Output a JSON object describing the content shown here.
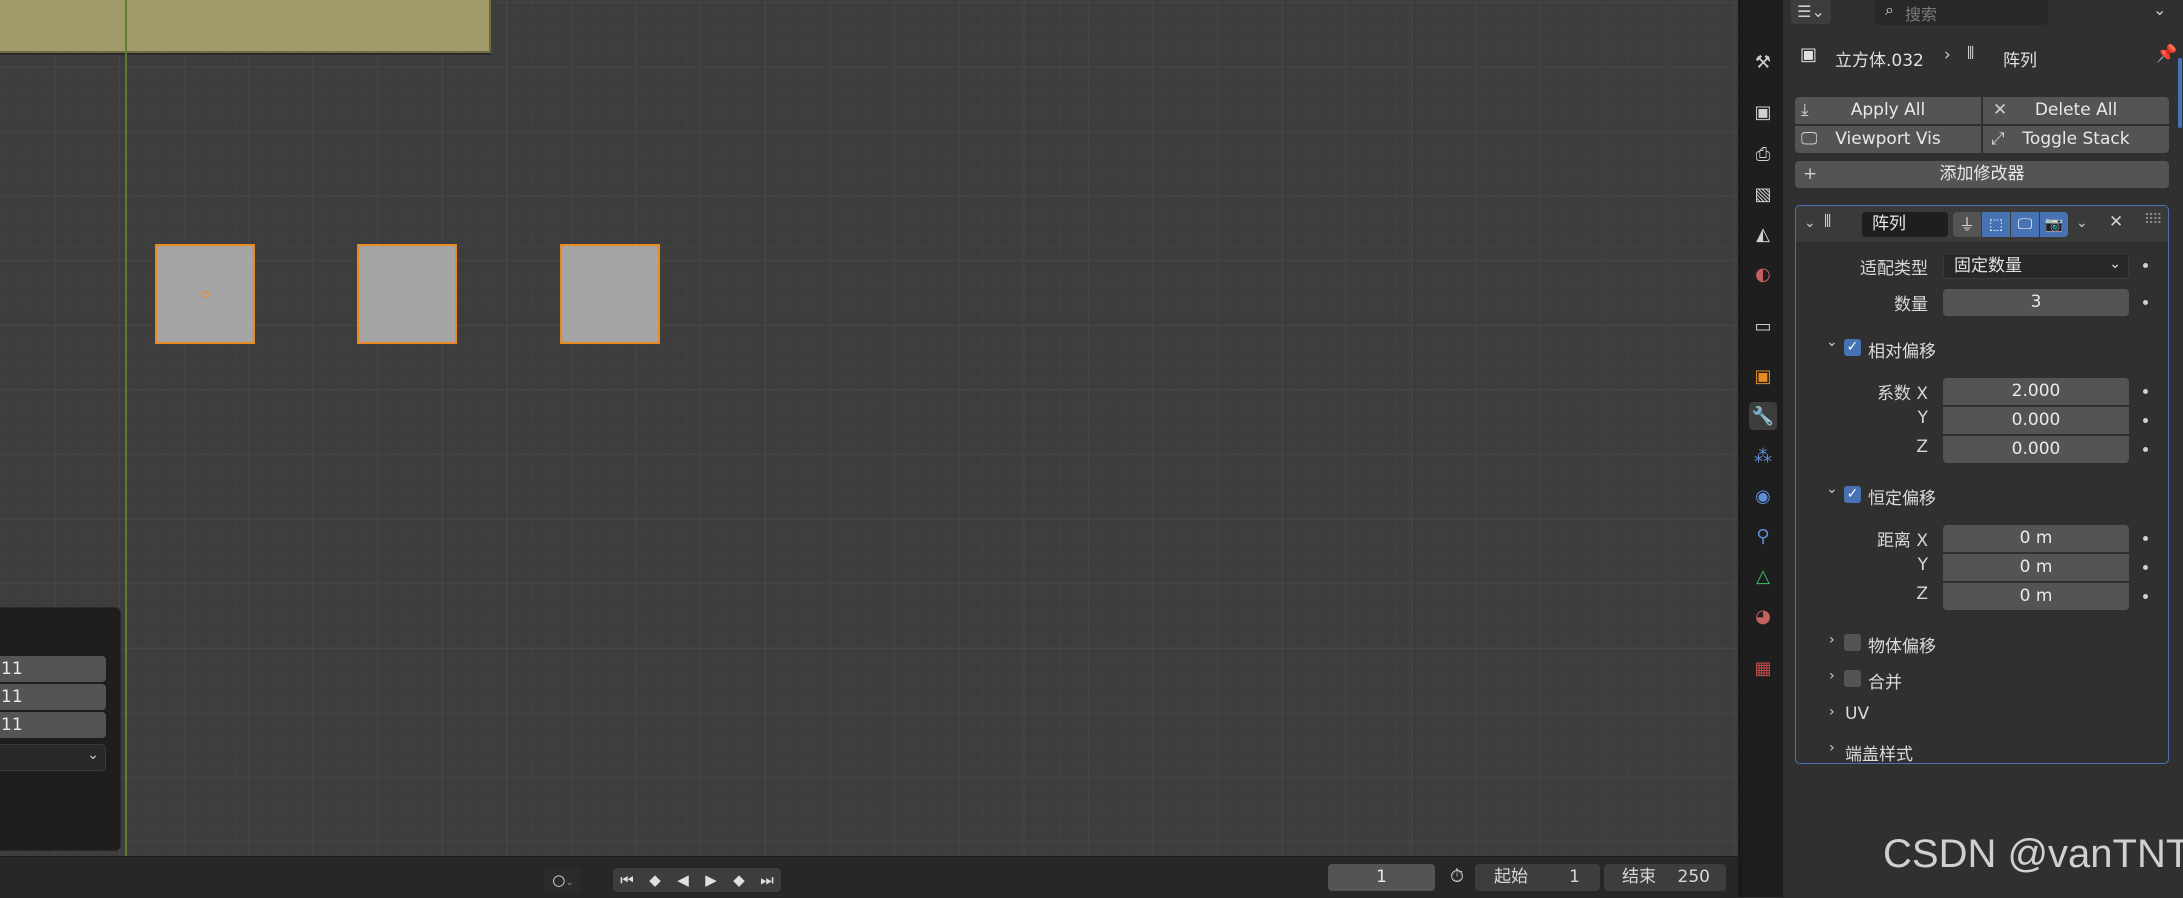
{
  "header": {
    "search_placeholder": "搜索",
    "object_name": "立方体.032",
    "modifier_context": "阵列"
  },
  "modifier_stack": {
    "apply_all": "Apply All",
    "delete_all": "Delete All",
    "viewport_vis": "Viewport Vis",
    "toggle_stack": "Toggle Stack",
    "add_modifier": "添加修改器"
  },
  "array_modifier": {
    "name": "阵列",
    "fit_type_label": "适配类型",
    "fit_type_value": "固定数量",
    "count_label": "数量",
    "count_value": "3",
    "relative_offset": {
      "label": "相对偏移",
      "enabled": true,
      "factor_x_label": "系数 X",
      "factor_x": "2.000",
      "y_label": "Y",
      "factor_y": "0.000",
      "z_label": "Z",
      "factor_z": "0.000"
    },
    "constant_offset": {
      "label": "恒定偏移",
      "enabled": true,
      "distance_x_label": "距离 X",
      "distance_x": "0 m",
      "y_label": "Y",
      "distance_y": "0 m",
      "z_label": "Z",
      "distance_z": "0 m"
    },
    "object_offset": {
      "label": "物体偏移",
      "enabled": false
    },
    "merge": {
      "label": "合并",
      "enabled": false
    },
    "uv_label": "UV",
    "caps_label": "端盖样式"
  },
  "operator_panel": {
    "values": [
      "11",
      "11",
      "11"
    ]
  },
  "timeline": {
    "current_frame": "1",
    "start_label": "起始",
    "start_value": "1",
    "end_label": "结束",
    "end_value": "250"
  },
  "watermark": "CSDN @vanTNT",
  "colors": {
    "accent": "#4772b3",
    "selection": "#e88a22",
    "camera_frame": "#a39a6c"
  }
}
